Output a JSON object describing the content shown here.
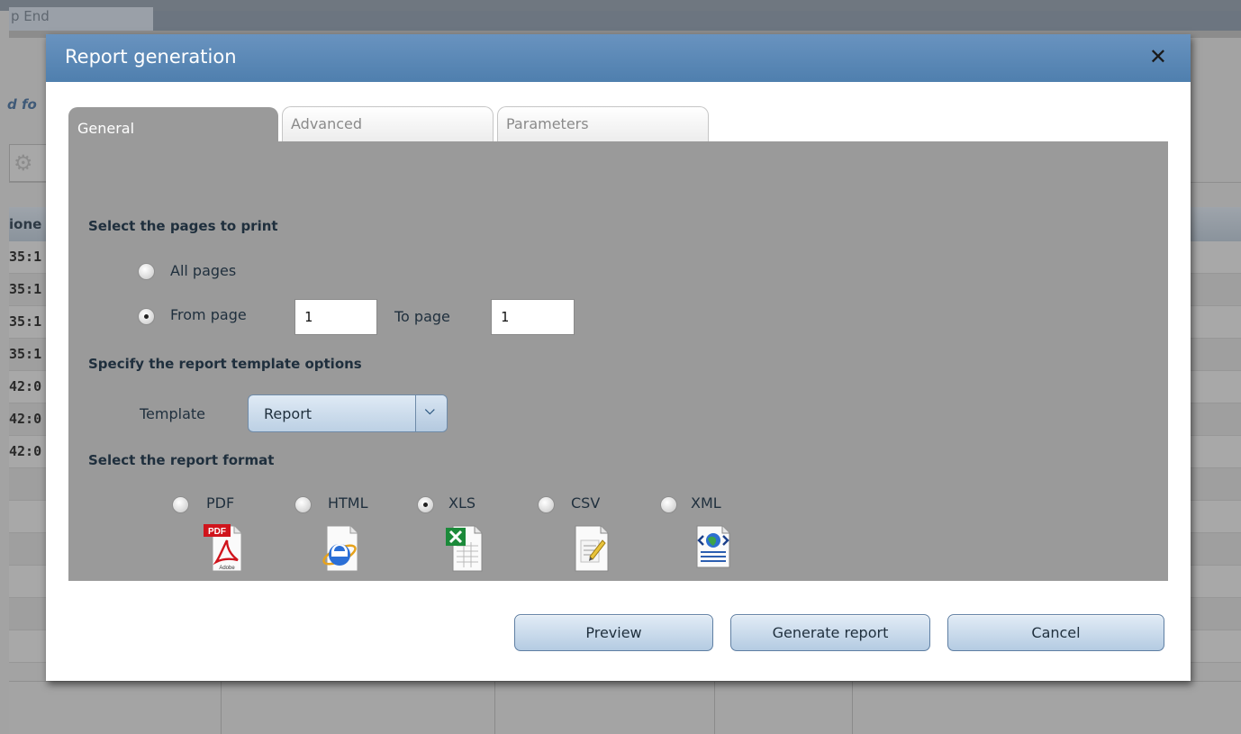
{
  "background": {
    "top_tab_label": "p End",
    "side_text": "d fo",
    "column_header": "ione",
    "rows": [
      "35:1",
      "35:1",
      "35:1",
      "35:1",
      "42:0",
      "42:0",
      "42:0"
    ]
  },
  "dialog": {
    "title": "Report generation",
    "close_glyph": "✕",
    "tabs": [
      {
        "label": "General",
        "active": true
      },
      {
        "label": "Advanced",
        "active": false
      },
      {
        "label": "Parameters",
        "active": false
      }
    ],
    "pages": {
      "heading": "Select the pages to print",
      "all_pages_label": "All pages",
      "from_page_label": "From page",
      "to_page_label": "To page",
      "from_value": "1",
      "to_value": "1",
      "selected": "from_page"
    },
    "template": {
      "heading": "Specify the report template options",
      "label": "Template",
      "selected": "Report"
    },
    "format": {
      "heading": "Select the report format",
      "options": [
        {
          "label": "PDF",
          "icon": "pdf-adobe-icon",
          "checked": false
        },
        {
          "label": "HTML",
          "icon": "internet-explorer-icon",
          "checked": false
        },
        {
          "label": "XLS",
          "icon": "excel-document-icon",
          "checked": true
        },
        {
          "label": "CSV",
          "icon": "text-document-icon",
          "checked": false
        },
        {
          "label": "XML",
          "icon": "xml-document-icon",
          "checked": false
        }
      ],
      "pdf_badge": "PDF",
      "adobe_text": "Adobe"
    },
    "buttons": {
      "preview": "Preview",
      "generate": "Generate report",
      "cancel": "Cancel"
    }
  },
  "colors": {
    "titlebar": "#5a88b6",
    "panel": "#9a9a9a",
    "button": "#c6d8ea"
  }
}
